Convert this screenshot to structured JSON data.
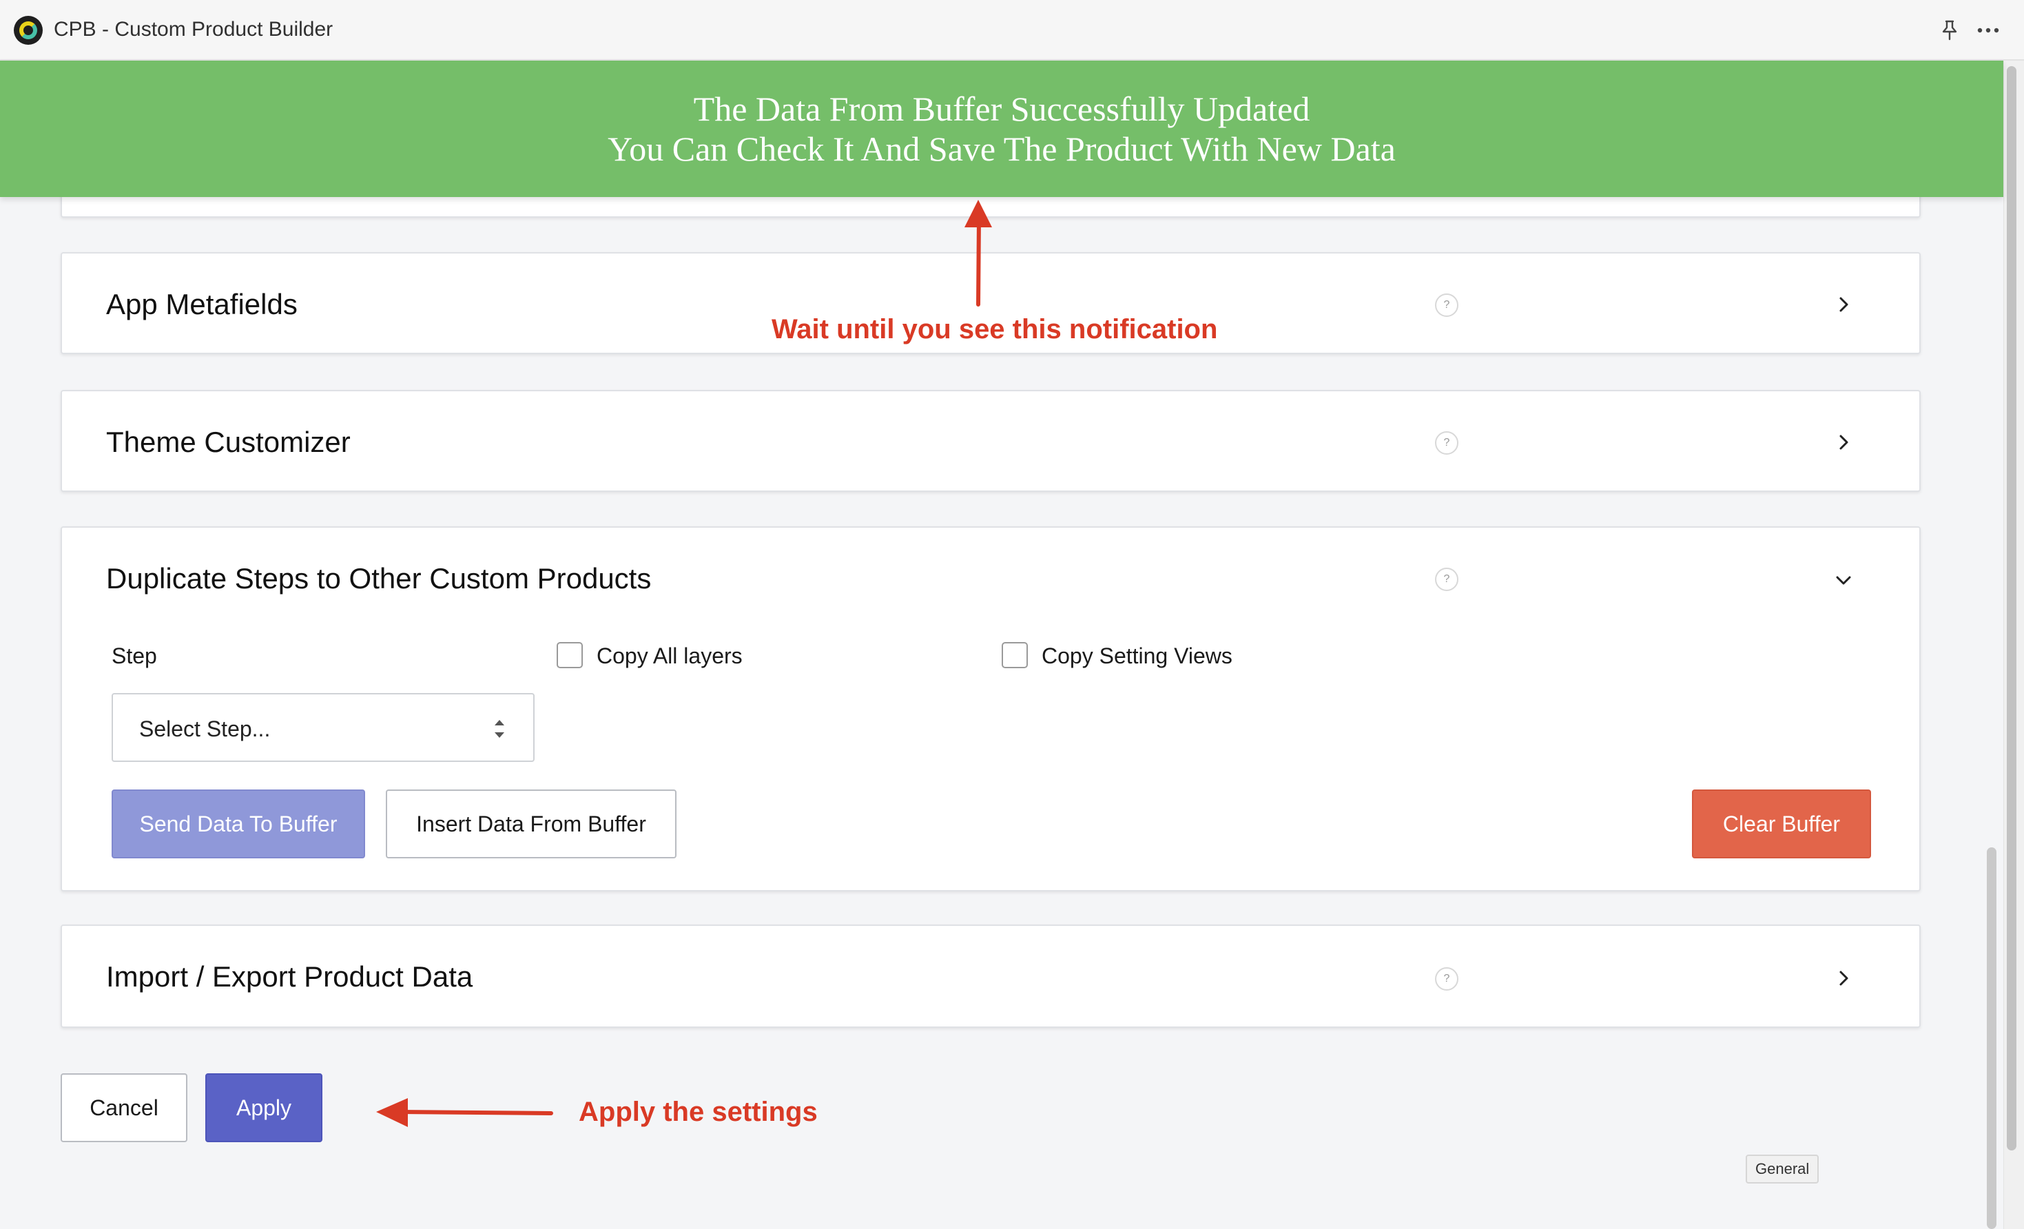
{
  "window": {
    "title": "CPB - Custom Product Builder"
  },
  "notification": {
    "line1": "The Data From Buffer Successfully Updated",
    "line2": "You Can Check It And Save The Product With New Data"
  },
  "sections": {
    "app_metafields": {
      "title": "App Metafields"
    },
    "theme_customizer": {
      "title": "Theme Customizer"
    },
    "duplicate_steps": {
      "title": "Duplicate Steps to Other Custom Products",
      "step_label": "Step",
      "copy_all_layers": "Copy All layers",
      "copy_setting_views": "Copy Setting Views",
      "select_placeholder": "Select Step...",
      "send_button": "Send Data To Buffer",
      "insert_button": "Insert Data From Buffer",
      "clear_button": "Clear Buffer"
    },
    "import_export": {
      "title": "Import / Export Product Data"
    }
  },
  "help_glyph": "?",
  "footer": {
    "cancel": "Cancel",
    "apply": "Apply"
  },
  "annotations": {
    "wait": "Wait until you see this notification",
    "apply": "Apply the settings"
  },
  "tooltip": "General",
  "colors": {
    "notification": "#75be69",
    "primary": "#5a62c6",
    "primary_light": "#8f98d9",
    "danger": "#e2654a",
    "annotation": "#d93a25"
  }
}
